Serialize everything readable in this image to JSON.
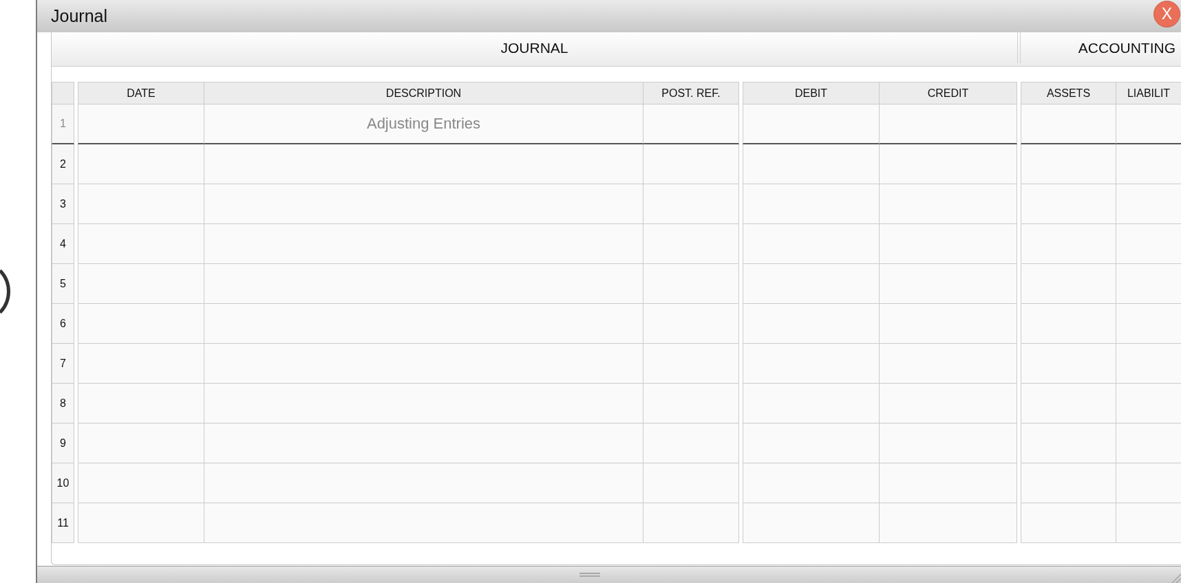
{
  "window": {
    "title": "Journal",
    "close_button": "X"
  },
  "header": {
    "sections": [
      {
        "label": "JOURNAL"
      },
      {
        "label": "ACCOUNTING"
      }
    ]
  },
  "table": {
    "column_groups": [
      {
        "columns": [
          "DATE",
          "DESCRIPTION",
          "POST. REF."
        ]
      },
      {
        "columns": [
          "DEBIT",
          "CREDIT"
        ]
      },
      {
        "columns": [
          "ASSETS",
          "LIABILIT"
        ]
      }
    ],
    "rows": [
      {
        "number": "1",
        "kind": "heading",
        "description": "Adjusting Entries"
      },
      {
        "number": "2",
        "kind": "entry"
      },
      {
        "number": "3",
        "kind": "entry"
      },
      {
        "number": "4",
        "kind": "entry"
      },
      {
        "number": "5",
        "kind": "entry"
      },
      {
        "number": "6",
        "kind": "entry"
      },
      {
        "number": "7",
        "kind": "entry"
      },
      {
        "number": "8",
        "kind": "entry"
      },
      {
        "number": "9",
        "kind": "entry"
      },
      {
        "number": "10",
        "kind": "entry"
      },
      {
        "number": "11",
        "kind": "entry"
      }
    ]
  }
}
